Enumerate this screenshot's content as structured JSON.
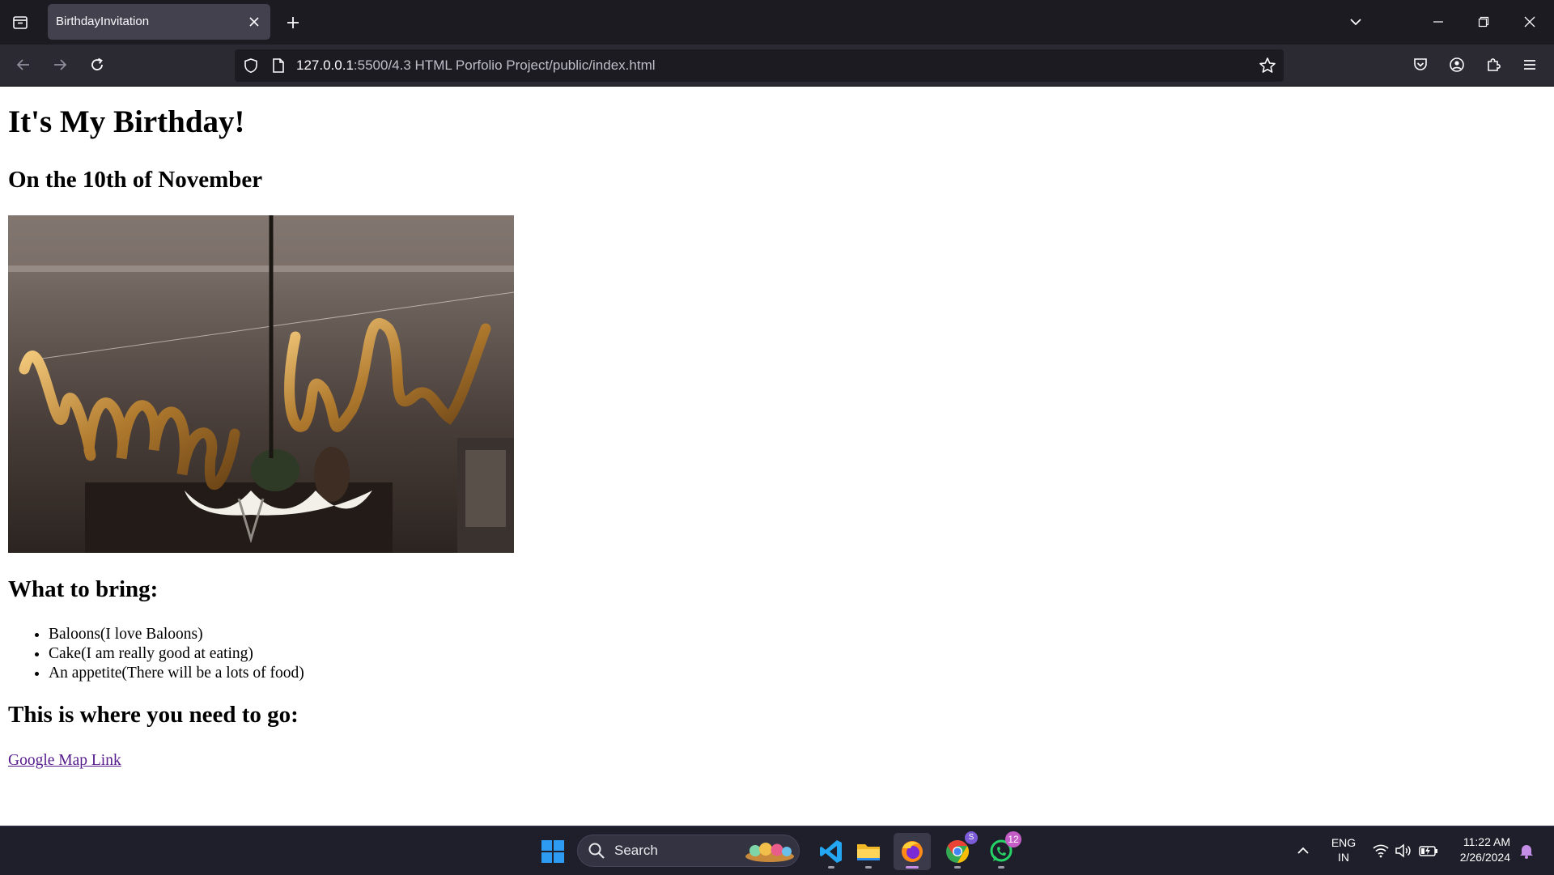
{
  "browser": {
    "tab": {
      "title": "BirthdayInvitation"
    },
    "url": {
      "host": "127.0.0.1",
      "path": ":5500/4.3 HTML Porfolio Project/public/index.html"
    }
  },
  "page": {
    "title": "It's My Birthday!",
    "subtitle": "On the 10th of November",
    "image": {
      "description_icon": "happy-bday-balloons-photo"
    },
    "bring_heading": "What to bring:",
    "bring_items": [
      "Baloons(I love Baloons)",
      "Cake(I am really good at eating)",
      "An appetite(There will be a lots of food)"
    ],
    "go_heading": "This is where you need to go:",
    "map_link": "Google Map Link"
  },
  "taskbar": {
    "search_label": "Search",
    "whatsapp_badge": "12",
    "chrome_badge": "S",
    "language": {
      "line1": "ENG",
      "line2": "IN"
    },
    "clock": {
      "time": "11:22 AM",
      "date": "2/26/2024"
    }
  },
  "colors": {
    "tab_strip": "#1c1b22",
    "toolbar": "#2b2a33",
    "link_visited": "#551a8b",
    "taskbar": "#1f1f2b"
  }
}
